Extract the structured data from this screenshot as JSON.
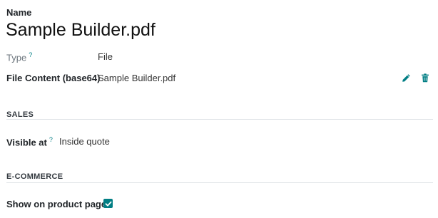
{
  "record": {
    "name_label": "Name",
    "name_value": "Sample Builder.pdf"
  },
  "fields": {
    "type_label": "Type",
    "type_value": "File",
    "file_content_label": "File Content (base64)",
    "file_content_value": "Sample Builder.pdf",
    "help_mark": "?"
  },
  "sales": {
    "title": "SALES",
    "visible_at_label": "Visible at",
    "visible_at_value": "Inside quote"
  },
  "ecommerce": {
    "title": "E-COMMERCE",
    "show_on_product_page_label": "Show on product page",
    "show_on_product_page_checked": true
  },
  "icons": {
    "edit": "pencil-icon",
    "delete": "trash-icon",
    "check": "checkmark-icon"
  },
  "colors": {
    "accent": "#017e84",
    "muted": "#6c757d",
    "rule": "#dee2e6"
  }
}
